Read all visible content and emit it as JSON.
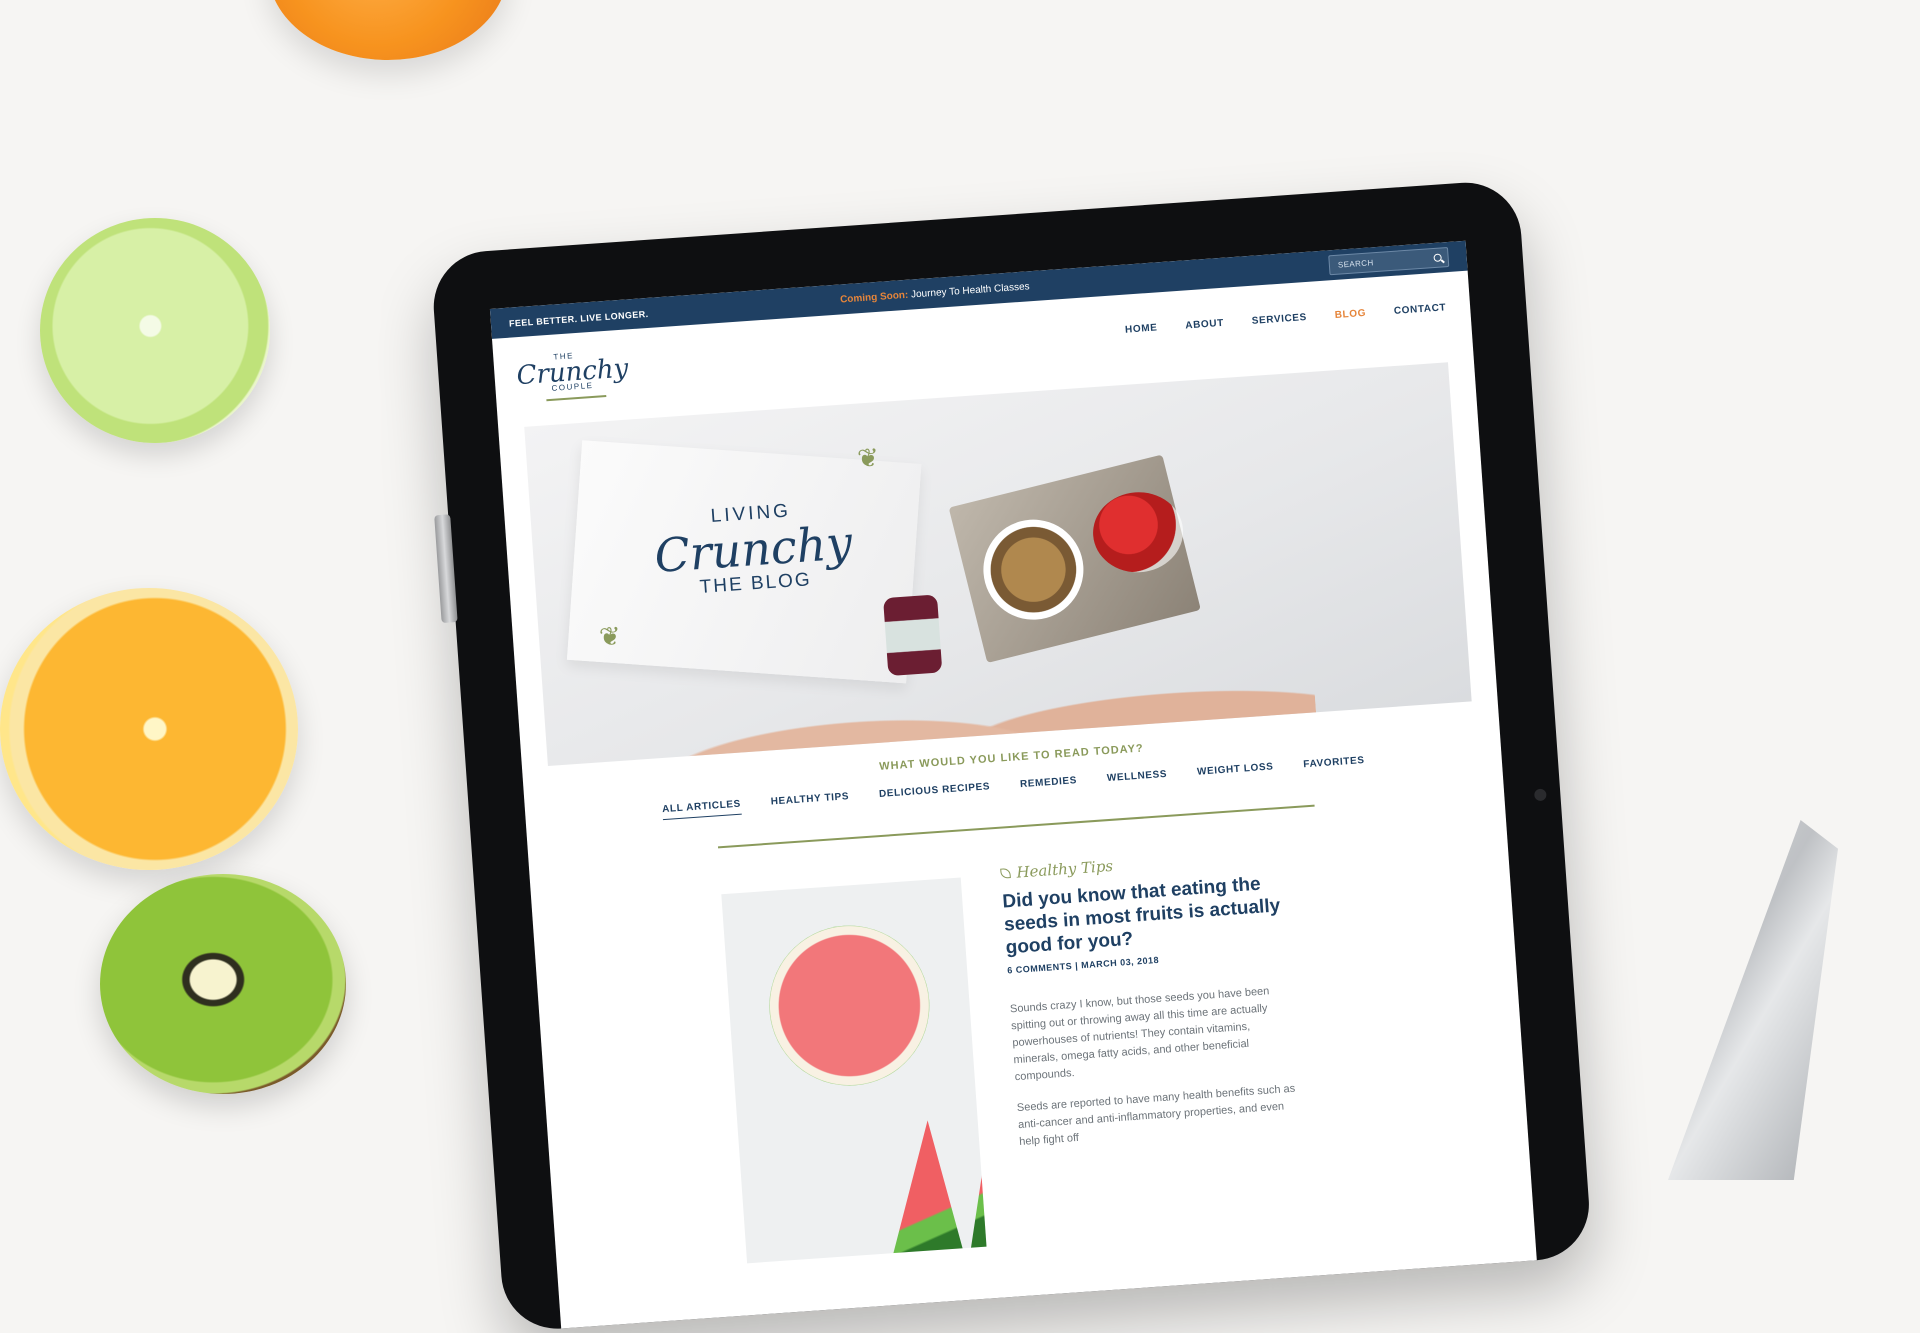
{
  "site": {
    "tagline": "FEEL BETTER. LIVE LONGER.",
    "announcement_prefix": "Coming Soon:",
    "announcement_text": "Journey To Health Classes",
    "search_placeholder": "SEARCH"
  },
  "logo": {
    "the": "THE",
    "script": "Crunchy",
    "couple": "COUPLE"
  },
  "nav": {
    "items": [
      "HOME",
      "ABOUT",
      "SERVICES",
      "BLOG",
      "CONTACT"
    ],
    "active": "BLOG"
  },
  "hero": {
    "living": "LIVING",
    "script": "Crunchy",
    "blog": "THE BLOG"
  },
  "categories": {
    "question": "WHAT WOULD YOU LIKE TO READ TODAY?",
    "items": [
      "ALL ARTICLES",
      "HEALTHY TIPS",
      "DELICIOUS RECIPES",
      "REMEDIES",
      "WELLNESS",
      "WEIGHT LOSS",
      "FAVORITES"
    ],
    "active": "ALL ARTICLES"
  },
  "post": {
    "category": "Healthy Tips",
    "title": "Did you know that eating the seeds in most fruits is actually good for you?",
    "comments": "6 COMMENTS",
    "separator": "|",
    "date": "MARCH 03, 2018",
    "excerpt": "Sounds crazy I know, but those seeds you have been spitting out or throwing away all this time are actually powerhouses of nutrients! They contain vitamins, minerals, omega fatty acids, and other beneficial compounds.",
    "excerpt2": "Seeds are reported to have many health benefits such as anti-cancer and anti-inflammatory properties, and even help fight off"
  },
  "colors": {
    "navy": "#1f4063",
    "accent_orange": "#e6853a",
    "olive": "#8a9a5b"
  }
}
